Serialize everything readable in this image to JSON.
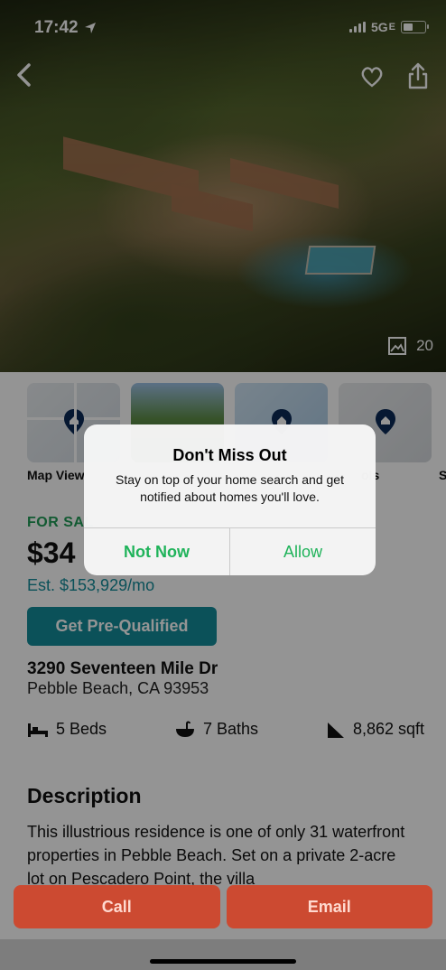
{
  "status_bar": {
    "time": "17:42",
    "network": "5G",
    "network_suffix": "E"
  },
  "gallery": {
    "photo_count": "20"
  },
  "thumbnails": [
    {
      "label": "Map View"
    },
    {
      "label": ""
    },
    {
      "label": ""
    },
    {
      "label": "ols"
    },
    {
      "label": "S"
    }
  ],
  "listing": {
    "status": "FOR SAL",
    "price": "$34",
    "est_payment": "Est. $153,929/mo",
    "prequal_label": "Get Pre-Qualified",
    "address": "3290 Seventeen Mile Dr",
    "city": "Pebble Beach, CA 93953",
    "beds": "5 Beds",
    "baths": "7 Baths",
    "sqft": "8,862 sqft",
    "description_title": "Description",
    "description": "This illustrious residence is one of only 31 waterfront properties in Pebble Beach. Set on a private 2-acre lot on Pescadero Point, the villa"
  },
  "actions": {
    "call_label": "Call",
    "email_label": "Email"
  },
  "alert": {
    "title": "Don't Miss Out",
    "message": "Stay on top of your home search and get notified about homes you'll love.",
    "not_now_label": "Not Now",
    "allow_label": "Allow"
  },
  "colors": {
    "accent_green": "#1fb35a",
    "teal": "#138c9a",
    "action_red": "#cc4a31"
  }
}
